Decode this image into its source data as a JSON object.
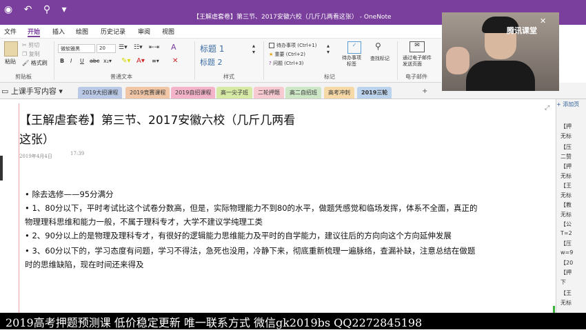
{
  "window": {
    "title": "【王解虐套卷】第三节、2017安徽六校（几斤几两看这张） - OneNote"
  },
  "menu": [
    "文件",
    "开始",
    "插入",
    "绘图",
    "历史记录",
    "审阅",
    "视图"
  ],
  "ribbon": {
    "clipboard": {
      "paste": "粘贴",
      "cut": "剪切",
      "copy": "复制",
      "format_painter": "格式刷",
      "label": "剪贴板"
    },
    "font": {
      "name": "微软雅黑",
      "size": "20",
      "label": "普通文本",
      "bold": "B",
      "italic": "I",
      "underline": "U",
      "strike": "abc"
    },
    "styles": {
      "h1": "标题 1",
      "h2": "标题 2",
      "label": "样式"
    },
    "tags": {
      "todo": "待办事项 (Ctrl+1)",
      "important": "重要 (Ctrl+2)",
      "question": "问题 (Ctrl+3)",
      "todo_tag": "待办事项\n标签",
      "find_tags": "查找标记",
      "label": "标记"
    },
    "email": {
      "send": "通过电子邮件发送页面",
      "label": "电子邮件"
    }
  },
  "notebook": {
    "name": "上课手写内容"
  },
  "sections": [
    {
      "label": "2019大招课程",
      "color": "#b9c9e6"
    },
    {
      "label": "2019竞赛课程",
      "color": "#f0c6a6"
    },
    {
      "label": "2019自招课程",
      "color": "#f3b3c8"
    },
    {
      "label": "高一尖子班",
      "color": "#d6eaa6"
    },
    {
      "label": "二轮押题",
      "color": "#f7c9d0"
    },
    {
      "label": "高二自招班",
      "color": "#cde6c6"
    },
    {
      "label": "高考冲刺",
      "color": "#f6d9a6"
    },
    {
      "label": "2019三轮",
      "color": "#bcd3ee"
    }
  ],
  "webcam": {
    "brand": "腾讯课堂"
  },
  "page": {
    "title_line1": "【王解虐套卷】第三节、2017安徽六校（几斤几两看",
    "title_line2": "这张）",
    "date": "2019年4月4日",
    "time": "17:39",
    "lines": [
      "•   除去选修——95分满分",
      "•   1、80分以下，平时考试比这个试卷分数高，但是，实际物理能力不到80的水平，做题凭感觉和临场发挥，体系不全面，真正的",
      "     物理理科思维和能力一般，不属于理科专才，大学不建议学纯理工类",
      "•   2、90分以上的是物理及理科专才，有很好的逻辑能力思维能力及平时的自学能力，建议往后的方向向这个方向延伸发展",
      "•   3、60分以下的，学习态度有问题，学习不得法，急死也没用，冷静下来，彻底重新梳理一遍脉络，查漏补缺，注意总结在做题",
      "     时的思维缺陷，现在时间还来得及"
    ]
  },
  "right_panel": {
    "add_page": "+ 添加页",
    "items": [
      "【押",
      "无标",
      "【压",
      "二赞",
      "【押",
      "无标",
      "【王",
      "无标",
      "【教",
      "无标",
      "【公",
      "T=2",
      "【压",
      "w=9",
      "【20",
      "【押",
      "下",
      "【王",
      "无标"
    ]
  },
  "caption": "2019高考押题预测课 低价稳定更新 唯一联系方式 微信gk2019bs QQ2272845198"
}
